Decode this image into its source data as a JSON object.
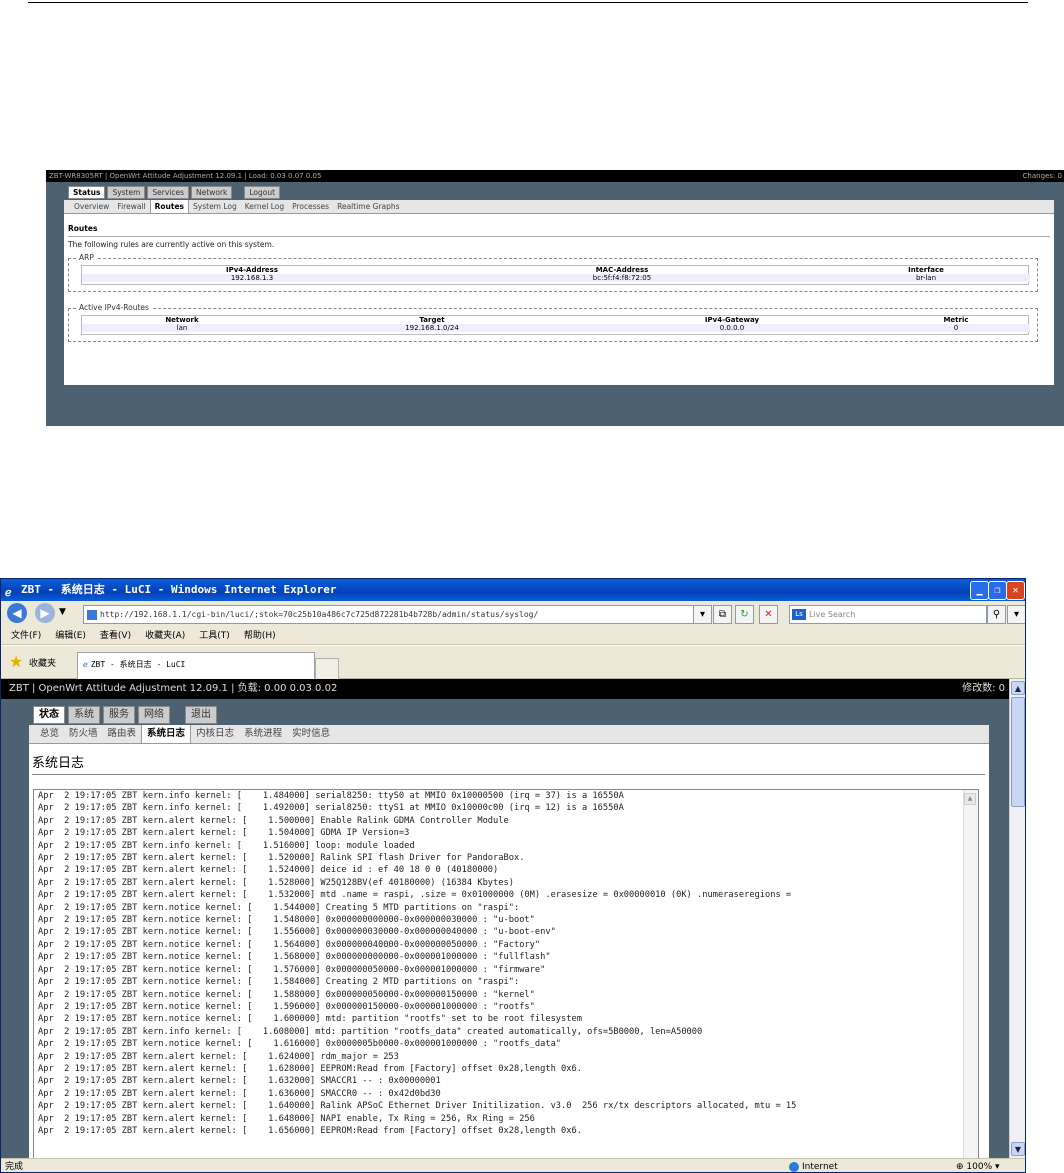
{
  "shot1": {
    "title_bar": {
      "left": "ZBT-WR8305RT | OpenWrt Attitude Adjustment 12.09.1 | Load: 0.03 0.07 0.05",
      "right": "Changes: 0"
    },
    "main_tabs": [
      "Status",
      "System",
      "Services",
      "Network"
    ],
    "logout": "Logout",
    "sub_tabs": [
      "Overview",
      "Firewall",
      "Routes",
      "System Log",
      "Kernel Log",
      "Processes",
      "Realtime Graphs"
    ],
    "active_sub_tab": "Routes",
    "page_title": "Routes",
    "description": "The following rules are currently active on this system.",
    "arp": {
      "legend": "ARP",
      "headers": [
        "IPv4-Address",
        "MAC-Address",
        "Interface"
      ],
      "row": [
        "192.168.1.3",
        "bc:5f:f4:f8:72:05",
        "br-lan"
      ]
    },
    "routes": {
      "legend": "Active IPv4-Routes",
      "headers": [
        "Network",
        "Target",
        "IPv4-Gateway",
        "Metric"
      ],
      "row": [
        "lan",
        "192.168.1.0/24",
        "0.0.0.0",
        "0"
      ]
    }
  },
  "shot2": {
    "window_title": "ZBT - 系统日志 - LuCI - Windows Internet Explorer",
    "address": "http://192.168.1.1/cgi-bin/luci/;stok=70c25b10a486c7c725d872281b4b728b/admin/status/syslog/",
    "search_placeholder": "Live Search",
    "menu": [
      "文件(F)",
      "编辑(E)",
      "查看(V)",
      "收藏夹(A)",
      "工具(T)",
      "帮助(H)"
    ],
    "favorites_label": "收藏夹",
    "tab_label": "ZBT - 系统日志 - LuCI",
    "title_bar": {
      "left": "ZBT | OpenWrt Attitude Adjustment 12.09.1 | 负载: 0.00 0.03 0.02",
      "right": "修改数: 0"
    },
    "main_tabs": [
      "状态",
      "系统",
      "服务",
      "网络"
    ],
    "logout": "退出",
    "sub_tabs": [
      "总览",
      "防火墙",
      "路由表",
      "系统日志",
      "内核日志",
      "系统进程",
      "实时信息"
    ],
    "active_sub_tab": "系统日志",
    "page_title": "系统日志",
    "log_lines": [
      "Apr  2 19:17:05 ZBT kern.info kernel: [    1.484000] serial8250: ttyS0 at MMIO 0x10000500 (irq = 37) is a 16550A",
      "Apr  2 19:17:05 ZBT kern.info kernel: [    1.492000] serial8250: ttyS1 at MMIO 0x10000c00 (irq = 12) is a 16550A",
      "Apr  2 19:17:05 ZBT kern.alert kernel: [    1.500000] Enable Ralink GDMA Controller Module",
      "Apr  2 19:17:05 ZBT kern.alert kernel: [    1.504000] GDMA IP Version=3",
      "Apr  2 19:17:05 ZBT kern.info kernel: [    1.516000] loop: module loaded",
      "Apr  2 19:17:05 ZBT kern.alert kernel: [    1.520000] Ralink SPI flash Driver for PandoraBox.",
      "Apr  2 19:17:05 ZBT kern.alert kernel: [    1.524000] deice id : ef 40 18 0 0 (40180000)",
      "Apr  2 19:17:05 ZBT kern.alert kernel: [    1.528000] W25Q128BV(ef 40180000) (16384 Kbytes)",
      "Apr  2 19:17:05 ZBT kern.alert kernel: [    1.532000] mtd .name = raspi, .size = 0x01000000 (0M) .erasesize = 0x00000010 (0K) .numeraseregions =",
      "Apr  2 19:17:05 ZBT kern.notice kernel: [    1.544000] Creating 5 MTD partitions on \"raspi\":",
      "Apr  2 19:17:05 ZBT kern.notice kernel: [    1.548000] 0x000000000000-0x000000030000 : \"u-boot\"",
      "Apr  2 19:17:05 ZBT kern.notice kernel: [    1.556000] 0x000000030000-0x000000040000 : \"u-boot-env\"",
      "Apr  2 19:17:05 ZBT kern.notice kernel: [    1.564000] 0x000000040000-0x000000050000 : \"Factory\"",
      "Apr  2 19:17:05 ZBT kern.notice kernel: [    1.568000] 0x000000000000-0x000001000000 : \"fullflash\"",
      "Apr  2 19:17:05 ZBT kern.notice kernel: [    1.576000] 0x000000050000-0x000001000000 : \"firmware\"",
      "Apr  2 19:17:05 ZBT kern.notice kernel: [    1.584000] Creating 2 MTD partitions on \"raspi\":",
      "Apr  2 19:17:05 ZBT kern.notice kernel: [    1.588000] 0x000000050000-0x000000150000 : \"kernel\"",
      "Apr  2 19:17:05 ZBT kern.notice kernel: [    1.596000] 0x000000150000-0x000001000000 : \"rootfs\"",
      "Apr  2 19:17:05 ZBT kern.notice kernel: [    1.600000] mtd: partition \"rootfs\" set to be root filesystem",
      "Apr  2 19:17:05 ZBT kern.info kernel: [    1.608000] mtd: partition \"rootfs_data\" created automatically, ofs=5B0000, len=A50000",
      "Apr  2 19:17:05 ZBT kern.notice kernel: [    1.616000] 0x0000005b0000-0x000001000000 : \"rootfs_data\"",
      "Apr  2 19:17:05 ZBT kern.alert kernel: [    1.624000] rdm_major = 253",
      "Apr  2 19:17:05 ZBT kern.alert kernel: [    1.628000] EEPROM:Read from [Factory] offset 0x28,length 0x6.",
      "Apr  2 19:17:05 ZBT kern.alert kernel: [    1.632000] SMACCR1 -- : 0x00000001",
      "Apr  2 19:17:05 ZBT kern.alert kernel: [    1.636000] SMACCR0 -- : 0x42d0bd30",
      "Apr  2 19:17:05 ZBT kern.alert kernel: [    1.640000] Ralink APSoC Ethernet Driver Initilization. v3.0  256 rx/tx descriptors allocated, mtu = 15",
      "Apr  2 19:17:05 ZBT kern.alert kernel: [    1.648000] NAPI enable, Tx Ring = 256, Rx Ring = 256",
      "Apr  2 19:17:05 ZBT kern.alert kernel: [    1.656000] EEPROM:Read from [Factory] offset 0x28,length 0x6."
    ],
    "status": {
      "left": "完成",
      "zone": "Internet",
      "zoom": "100%"
    }
  }
}
